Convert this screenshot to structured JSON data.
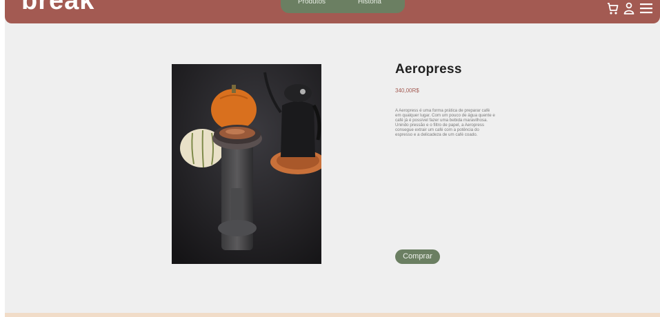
{
  "header": {
    "brand": "break",
    "nav": [
      {
        "label": "Produtos"
      },
      {
        "label": "História"
      }
    ],
    "icons": [
      "cart-icon",
      "user-icon",
      "menu-icon"
    ]
  },
  "product": {
    "title": "Aeropress",
    "price": "340,00R$",
    "description": "A Aeropress é uma forma prática de preparar café em qualquer lugar. Com um pouco de água quente e café já é possível fazer uma bebida maravilhosa. Unindo pressão e o filtro de papel, a Aeropress consegue extrair um café com a potência do espresso e a delicadeza de um café coado.",
    "buy_label": "Comprar"
  },
  "colors": {
    "header": "#a35a52",
    "accent_green": "#6b7f62",
    "price": "#a35a52",
    "background": "#efefef"
  }
}
